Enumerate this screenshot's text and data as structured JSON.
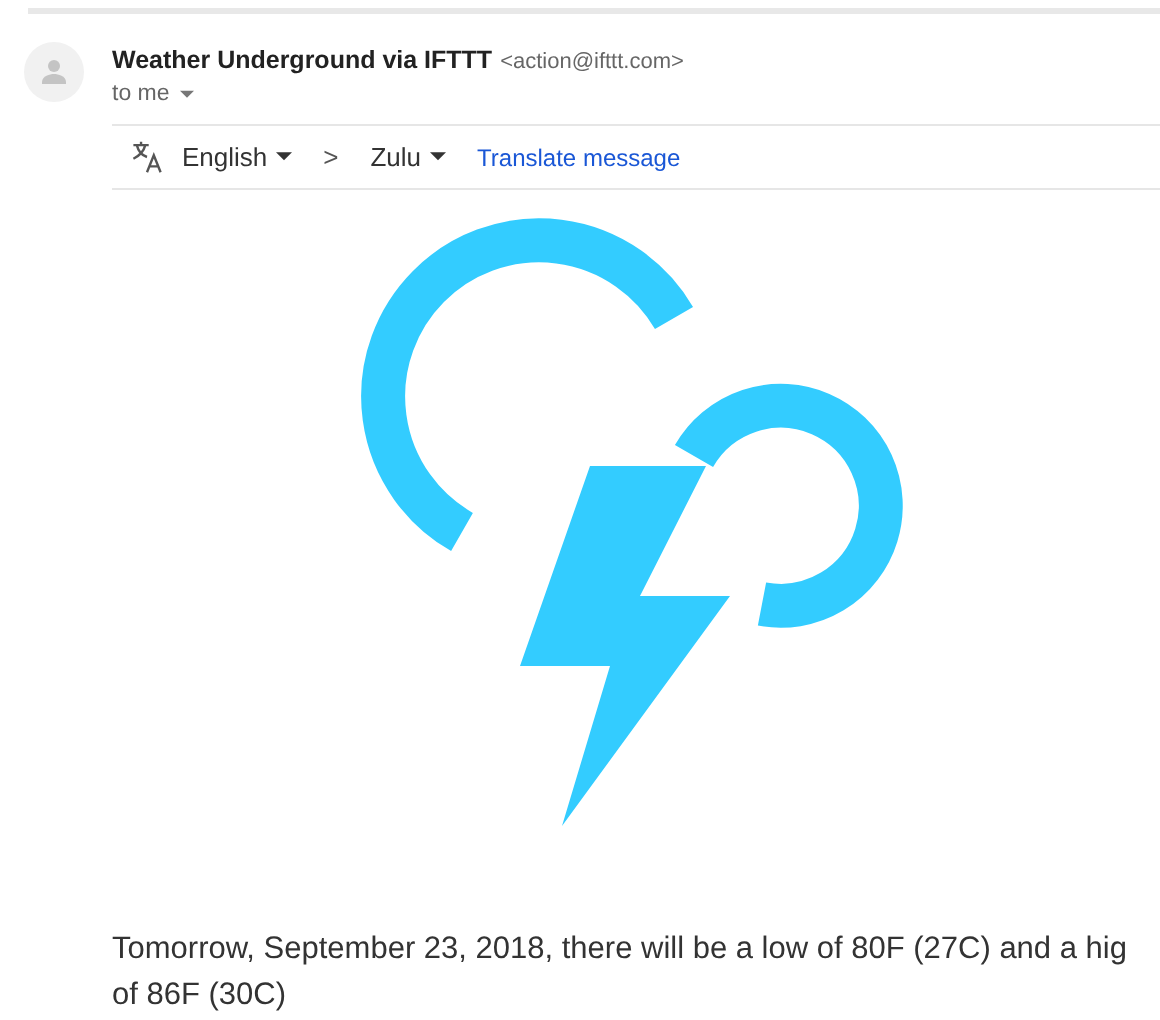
{
  "message": {
    "sender": "Weather Underground via IFTTT",
    "address": "<action@ifttt.com>",
    "recipient": "to me"
  },
  "translate_bar": {
    "source_language": "English",
    "separator": ">",
    "target_language": "Zulu",
    "action": "Translate message"
  },
  "body": {
    "lines": [
      "Tomorrow, September 23, 2018, there will be a low of 80F (27C) and a hig",
      "of 86F (30C)"
    ]
  }
}
